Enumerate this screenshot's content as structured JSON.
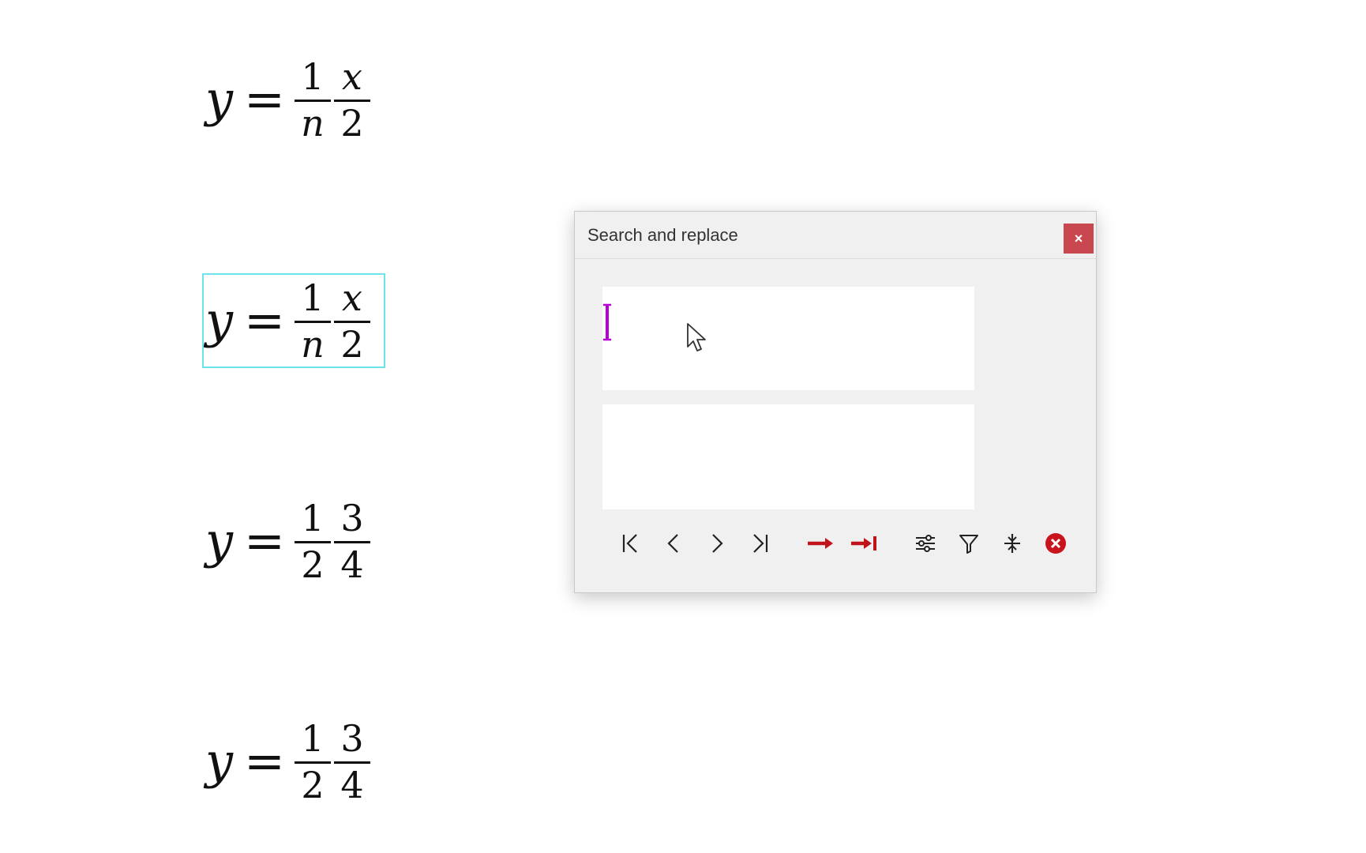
{
  "equations": [
    {
      "lhs": "y",
      "equals": "=",
      "frac1": {
        "num": "1",
        "den": "n"
      },
      "frac2": {
        "num": "x",
        "den": "2"
      },
      "selected": false
    },
    {
      "lhs": "y",
      "equals": "=",
      "frac1": {
        "num": "1",
        "den": "n"
      },
      "frac2": {
        "num": "x",
        "den": "2"
      },
      "selected": true
    },
    {
      "lhs": "y",
      "equals": "=",
      "frac1": {
        "num": "1",
        "den": "2"
      },
      "frac2": {
        "num": "3",
        "den": "4"
      },
      "selected": false
    },
    {
      "lhs": "y",
      "equals": "=",
      "frac1": {
        "num": "1",
        "den": "2"
      },
      "frac2": {
        "num": "3",
        "den": "4"
      },
      "selected": false
    }
  ],
  "dialog": {
    "title": "Search and replace",
    "close_glyph": "×",
    "search_value": "",
    "replace_value": "",
    "toolbar": [
      {
        "name": "first-match-icon"
      },
      {
        "name": "previous-match-icon"
      },
      {
        "name": "next-match-icon"
      },
      {
        "name": "last-match-icon"
      },
      {
        "name": "replace-icon"
      },
      {
        "name": "replace-all-icon"
      },
      {
        "name": "options-sliders-icon"
      },
      {
        "name": "filter-icon"
      },
      {
        "name": "split-icon"
      },
      {
        "name": "clear-icon"
      }
    ]
  },
  "colors": {
    "selection_outline": "#6fe3ea",
    "close_button": "#c9484f",
    "replace_arrows": "#c0131a",
    "clear_button": "#c8141c",
    "caret": "#b600d4"
  }
}
